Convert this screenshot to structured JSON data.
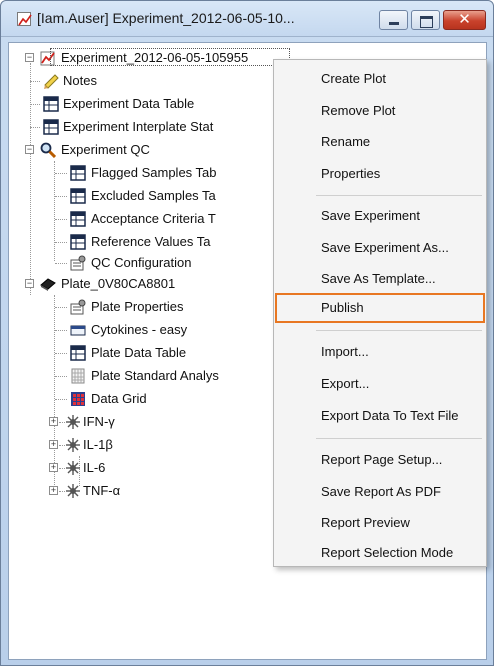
{
  "window": {
    "title": "[Iam.Auser] Experiment_2012-06-05-10...",
    "close_glyph": "✕"
  },
  "tree": {
    "root_label": "Experiment_2012-06-05-105955",
    "items": [
      {
        "label": "Notes",
        "icon": "notes-icon"
      },
      {
        "label": "Experiment Data Table",
        "icon": "table-icon"
      },
      {
        "label": "Experiment Interplate Stat",
        "icon": "table-icon"
      },
      {
        "label": "Experiment QC",
        "icon": "search-icon"
      },
      {
        "label": "Flagged Samples Tab",
        "icon": "table-icon"
      },
      {
        "label": "Excluded Samples Ta",
        "icon": "table-icon"
      },
      {
        "label": "Acceptance Criteria T",
        "icon": "table-icon"
      },
      {
        "label": "Reference Values Ta",
        "icon": "table-icon"
      },
      {
        "label": "QC Configuration",
        "icon": "config-icon"
      },
      {
        "label": "Plate_0V80CA8801",
        "icon": "plate-icon"
      },
      {
        "label": "Plate Properties",
        "icon": "config-icon"
      },
      {
        "label": "Cytokines - easy",
        "icon": "panel-icon"
      },
      {
        "label": "Plate Data Table",
        "icon": "table-icon"
      },
      {
        "label": "Plate Standard Analys",
        "icon": "grid-icon"
      },
      {
        "label": "Data Grid",
        "icon": "data-grid-icon"
      },
      {
        "label": "IFN-γ",
        "icon": "analyte-icon"
      },
      {
        "label": "IL-1β",
        "icon": "analyte-icon"
      },
      {
        "label": "IL-6",
        "icon": "analyte-icon"
      },
      {
        "label": "TNF-α",
        "icon": "analyte-icon"
      }
    ]
  },
  "context_menu": {
    "highlight_color": "#e87722",
    "items": [
      "Create Plot",
      "Remove Plot",
      "Rename",
      "Properties",
      "Save Experiment",
      "Save Experiment As...",
      "Save As Template...",
      "Publish",
      "Import...",
      "Export...",
      "Export Data To Text File",
      "Report Page Setup...",
      "Save Report As PDF",
      "Report Preview",
      "Report Selection Mode"
    ],
    "highlighted": "Publish"
  }
}
